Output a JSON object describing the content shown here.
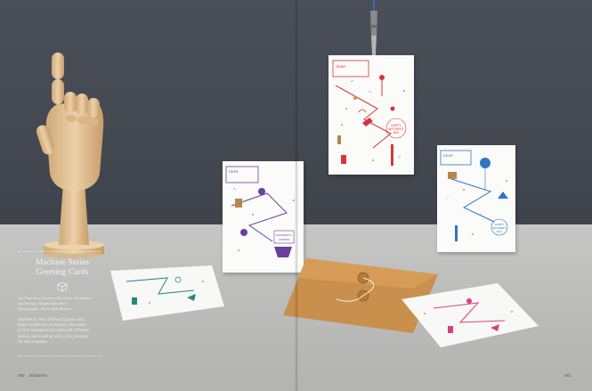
{
  "title": "Machine Series Greeting Cards",
  "title_line1": "Machine Series",
  "title_line2": "Greeting Cards",
  "credits": [
    "Art Direction, Creative Direction, Illustration",
    "and Design: Magda Marchese",
    "Photography: Ian Grimbeek-brio"
  ],
  "description": [
    "Inspired by the childhood games and",
    "Rube Goldberg's inventions, the series",
    "of five letterpress A6 cards tell different",
    "stories, each ending with a fun greeting",
    "for the recipient."
  ],
  "footer": {
    "left_page_number": "080",
    "left_section": "Invitations",
    "right_page_number": "081"
  },
  "cards": {
    "to_label": "DEAR",
    "mothers_day_line1": "HAPPY",
    "mothers_day_line2": "MOTHER'S",
    "mothers_day_line3": "DAY",
    "congrats_line1": "CONGRATU-",
    "congrats_line2": "LATIONS"
  },
  "colors": {
    "wall": "#454a53",
    "table": "#bebebc",
    "card": "#fbfbf9",
    "envelope": "#c98f4c",
    "red": "#d8343d",
    "blue": "#2e76c0",
    "purple": "#6b3f9c",
    "teal": "#1f8a78",
    "pink": "#d8427a"
  },
  "objects": [
    "wooden-hand-mannequin",
    "metal-clip",
    "kraft-string-envelope"
  ]
}
